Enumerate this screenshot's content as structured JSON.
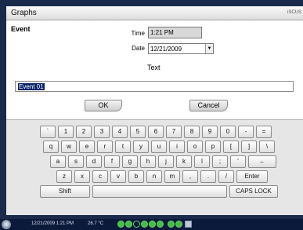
{
  "window": {
    "title": "Graphs",
    "brand": "iSCUS"
  },
  "dialog": {
    "heading": "Event",
    "time_label": "Time",
    "time_value": "1:21 PM",
    "date_label": "Date",
    "date_value": "12/21/2009",
    "text_label": "Text",
    "text_value": "Event 01",
    "ok_label": "OK",
    "cancel_label": "Cancel"
  },
  "keyboard": {
    "row1": [
      "`",
      "1",
      "2",
      "3",
      "4",
      "5",
      "6",
      "7",
      "8",
      "9",
      "0",
      "-",
      "="
    ],
    "row2": [
      "q",
      "w",
      "e",
      "r",
      "t",
      "y",
      "u",
      "i",
      "o",
      "p",
      "[",
      "]",
      "\\"
    ],
    "row3": [
      "a",
      "s",
      "d",
      "f",
      "g",
      "h",
      "j",
      "k",
      "l",
      ";",
      "'",
      "←"
    ],
    "row4": [
      "z",
      "x",
      "c",
      "v",
      "b",
      "n",
      "m",
      ",",
      ".",
      "/",
      "Enter"
    ],
    "shift_label": "Shift",
    "caps_label": "CAPS LOCK"
  },
  "taskbar": {
    "datetime": "12/21/2009 1:21 PM",
    "temperature": "26.7 °C"
  },
  "colors": {
    "selection": "#0a246a",
    "status_green": "#43c043",
    "taskbar": "#0b1a3a"
  }
}
